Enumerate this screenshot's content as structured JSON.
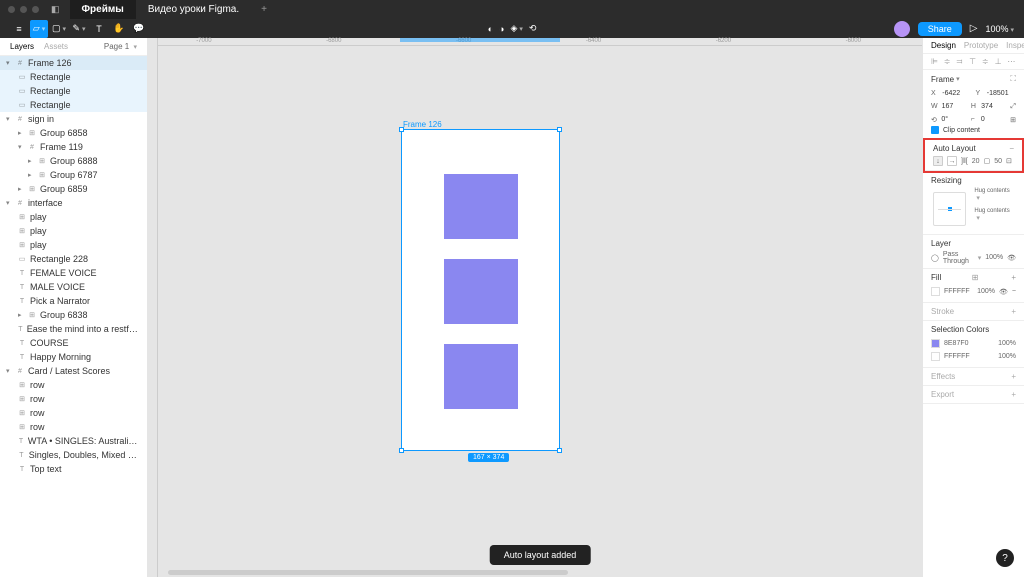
{
  "topbar": {
    "tab1": "Фреймы",
    "tab2": "Видео уроки Figma."
  },
  "toolbar": {
    "share": "Share",
    "zoom": "100%"
  },
  "leftPanel": {
    "layersTab": "Layers",
    "assetsTab": "Assets",
    "page": "Page 1",
    "layers": {
      "frame126": "Frame 126",
      "rect1": "Rectangle",
      "rect2": "Rectangle",
      "rect3": "Rectangle",
      "signin": "sign in",
      "group6858": "Group 6858",
      "frame119": "Frame 119",
      "group6888": "Group 6888",
      "group6787": "Group 6787",
      "group6859": "Group 6859",
      "interface": "interface",
      "play1": "play",
      "play2": "play",
      "play3": "play",
      "rect228": "Rectangle 228",
      "femaleVoice": "FEMALE VOICE",
      "maleVoice": "MALE VOICE",
      "pickNarrator": "Pick a Narrator",
      "group6838": "Group 6838",
      "easeMind": "Ease the mind into a restful night's sleep with t...",
      "course": "COURSE",
      "happyMorning": "Happy Morning",
      "cardScores": "Card / Latest Scores",
      "row1": "row",
      "row2": "row",
      "row3": "row",
      "row4": "row",
      "wta": "WTA • SINGLES: Australia Open, hard",
      "singles": "Singles, Doubles, Mixed Doubles",
      "topText": "Top text"
    }
  },
  "canvas": {
    "frameLabel": "Frame 126",
    "dimensions": "167 × 374",
    "toast": "Auto layout added"
  },
  "ruler": {
    "t0": "-7000",
    "t1": "-6800",
    "t2": "-6600",
    "t3": "-6400",
    "t4": "-6200",
    "t5": "-6000"
  },
  "rightPanel": {
    "designTab": "Design",
    "prototypeTab": "Prototype",
    "inspectTab": "Inspect",
    "frame": {
      "label": "Frame",
      "x": "-6422",
      "y": "-18501",
      "w": "167",
      "h": "374",
      "rot": "0°",
      "rad": "0",
      "clip": "Clip content"
    },
    "autoLayout": {
      "label": "Auto Layout",
      "spacing": "20",
      "padding": "50"
    },
    "resizing": {
      "label": "Resizing",
      "hugW": "Hug contents",
      "hugH": "Hug contents"
    },
    "layer": {
      "label": "Layer",
      "blend": "Pass Through",
      "opacity": "100%"
    },
    "fill": {
      "label": "Fill",
      "color": "FFFFFF",
      "opacity": "100%"
    },
    "stroke": {
      "label": "Stroke"
    },
    "selectionColors": {
      "label": "Selection Colors",
      "c1": "8E87F0",
      "c1o": "100%",
      "c2": "FFFFFF",
      "c2o": "100%"
    },
    "effects": {
      "label": "Effects"
    },
    "export": {
      "label": "Export"
    }
  }
}
